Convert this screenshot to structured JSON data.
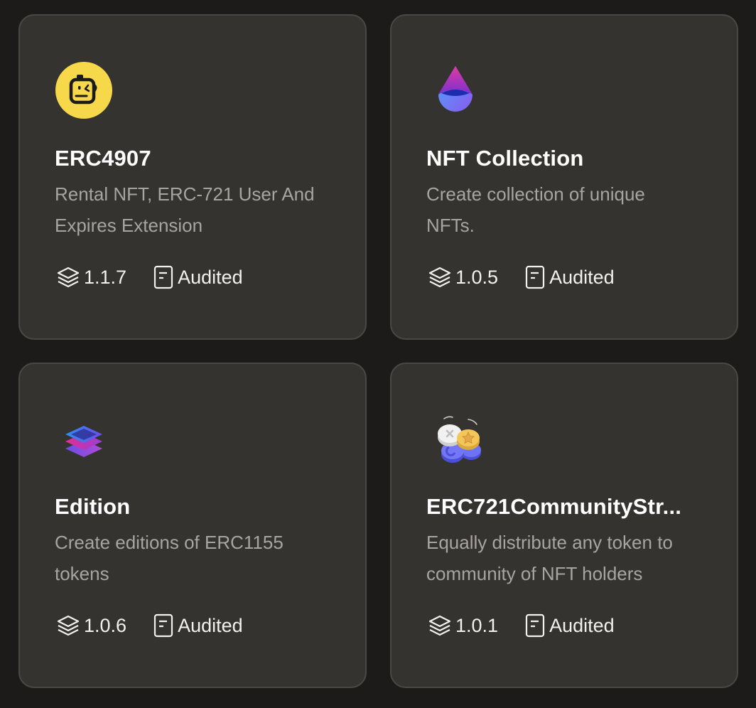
{
  "cards": [
    {
      "title": "ERC4907",
      "description": "Rental NFT, ERC-721 User And Expires Extension",
      "version": "1.1.7",
      "audit_label": "Audited",
      "icon": "robot-face-icon",
      "icon_color": "#f6d84a"
    },
    {
      "title": "NFT Collection",
      "description": "Create collection of unique NFTs.",
      "version": "1.0.5",
      "audit_label": "Audited",
      "icon": "drop-icon",
      "icon_color": "#8a3fd1"
    },
    {
      "title": "Edition",
      "description": "Create editions of ERC1155 tokens",
      "version": "1.0.6",
      "audit_label": "Audited",
      "icon": "layers-stack-icon",
      "icon_color": "#6a5cf0"
    },
    {
      "title": "ERC721CommunityStr...",
      "description": "Equally distribute any token to community of NFT holders",
      "version": "1.0.1",
      "audit_label": "Audited",
      "icon": "coins-pile-icon",
      "icon_color": "#6b6ef5"
    }
  ],
  "colors": {
    "background": "#1c1b1a",
    "card": "#353330",
    "card_border": "#4a4845",
    "title": "#ffffff",
    "description": "#a8a5a0",
    "meta": "#f2f1ef"
  }
}
